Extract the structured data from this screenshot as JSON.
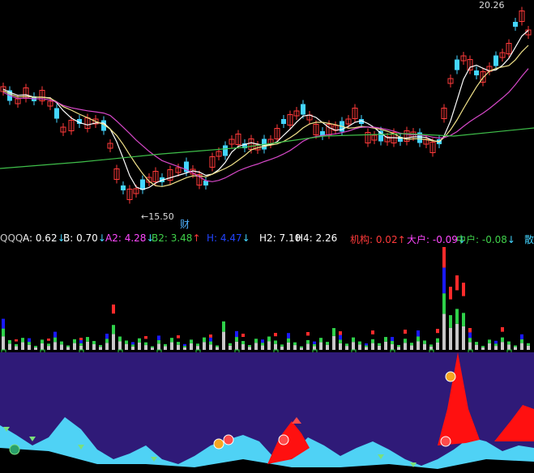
{
  "colors": {
    "background": "#000000",
    "up": "#ff3a3a",
    "down": "#44d5ff",
    "ma_white": "#ffffff",
    "ma_yellow": "#f2e38a",
    "ma_magenta": "#d648c8",
    "ma_green": "#3fbf4a",
    "fill_purple": "#2f1a78",
    "fill_cyan": "#4fd2f5",
    "fill_red": "#ff1010",
    "bar_red": "#ff2b2b",
    "bar_green": "#2fd14a",
    "bar_blue": "#1a1aff",
    "bar_gray": "#c8c8c8"
  },
  "price_panel": {
    "high_label": "20.26",
    "low_label": "15.50",
    "marker_text": "财"
  },
  "indicator_legend": [
    {
      "text": "QQQ",
      "color": "#c8c8c8"
    },
    {
      "text": "A: 0.62",
      "color": "#ffffff",
      "arrow": "↓",
      "arrow_color": "#44d5ff"
    },
    {
      "text": "B: 0.70",
      "color": "#ffffff",
      "arrow": "↓",
      "arrow_color": "#44d5ff"
    },
    {
      "text": "A2: 4.28",
      "color": "#ff48ff",
      "arrow": "↓",
      "arrow_color": "#44d5ff"
    },
    {
      "text": "B2: 3.48",
      "color": "#3fd14a",
      "arrow": "↑",
      "arrow_color": "#ff3a3a"
    },
    {
      "text": "H: 4.47",
      "color": "#2244ff",
      "arrow": "↓",
      "arrow_color": "#44d5ff"
    },
    {
      "text": "H2: 7.10",
      "color": "#ffffff"
    },
    {
      "text": "H4: 2.26",
      "color": "#ffffff"
    },
    {
      "text": "机构: 0.02",
      "color": "#ff3a3a",
      "arrow": "↑",
      "arrow_color": "#ff3a3a"
    },
    {
      "text": "大户: -0.09",
      "color": "#ff48ff",
      "arrow": "↓",
      "arrow_color": "#44d5ff"
    },
    {
      "text": "中户: -0.08",
      "color": "#3fd14a",
      "arrow": "↓",
      "arrow_color": "#44d5ff"
    },
    {
      "text": "散",
      "color": "#44d5ff"
    }
  ]
}
